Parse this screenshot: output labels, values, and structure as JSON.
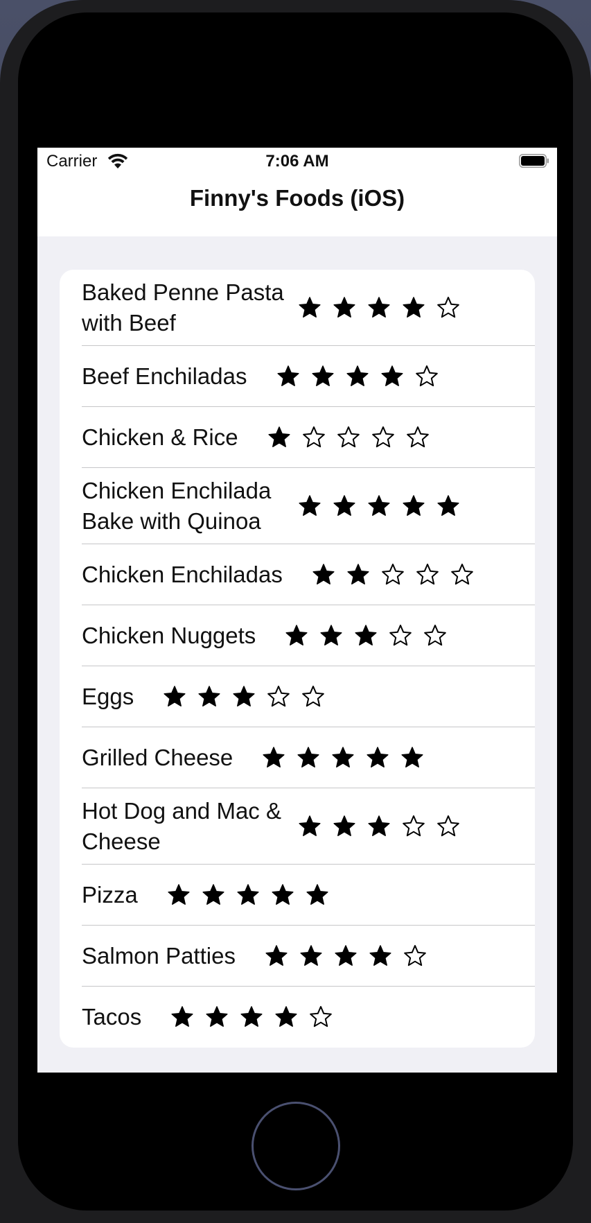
{
  "status_bar": {
    "carrier": "Carrier",
    "time": "7:06 AM"
  },
  "nav": {
    "title": "Finny's Foods (iOS)"
  },
  "foods": [
    {
      "name": "Baked Penne Pasta with Beef",
      "rating": 4
    },
    {
      "name": "Beef Enchiladas",
      "rating": 4
    },
    {
      "name": "Chicken & Rice",
      "rating": 1
    },
    {
      "name": "Chicken Enchilada Bake with Quinoa",
      "rating": 5
    },
    {
      "name": "Chicken Enchiladas",
      "rating": 2
    },
    {
      "name": "Chicken Nuggets",
      "rating": 3
    },
    {
      "name": "Eggs",
      "rating": 3
    },
    {
      "name": "Grilled Cheese",
      "rating": 5
    },
    {
      "name": "Hot Dog and Mac & Cheese",
      "rating": 3
    },
    {
      "name": "Pizza",
      "rating": 5
    },
    {
      "name": "Salmon Patties",
      "rating": 4
    },
    {
      "name": "Tacos",
      "rating": 4
    }
  ],
  "rating_max": 5,
  "icons": {
    "filled_star": "star-filled-icon",
    "empty_star": "star-outline-icon",
    "wifi": "wifi-icon",
    "battery": "battery-icon"
  }
}
